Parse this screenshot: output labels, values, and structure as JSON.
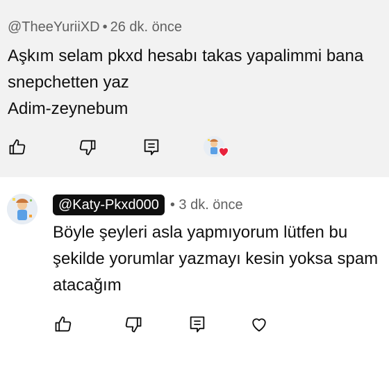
{
  "parent_comment": {
    "author": "@TheeYuriiXD",
    "separator": "•",
    "time": "26 dk. önce",
    "lines": [
      "Aşkım selam pkxd hesabı takas yapalimmi bana",
      "snepchetten yaz",
      "Adim-zeynebum"
    ],
    "actions": [
      "like-icon",
      "dislike-icon",
      "reply-icon"
    ],
    "creator_heart": "heart-icon"
  },
  "reply_comment": {
    "author": "@Katy-Pkxd000",
    "time": "• 3 dk. önce",
    "lines": [
      "Böyle şeyleri asla yapmıyorum lütfen bu",
      "şekilde yorumlar yazmayı kesin yoksa spam",
      "atacağım"
    ],
    "actions": [
      "like-icon",
      "dislike-icon",
      "reply-icon",
      "heart-outline-icon"
    ]
  },
  "colors": {
    "top_background": "#f2f2f2",
    "text": "#0f0f0f",
    "meta_text": "#606060",
    "heart_red": "#e8223c",
    "chip_background": "#0f0f0f"
  }
}
